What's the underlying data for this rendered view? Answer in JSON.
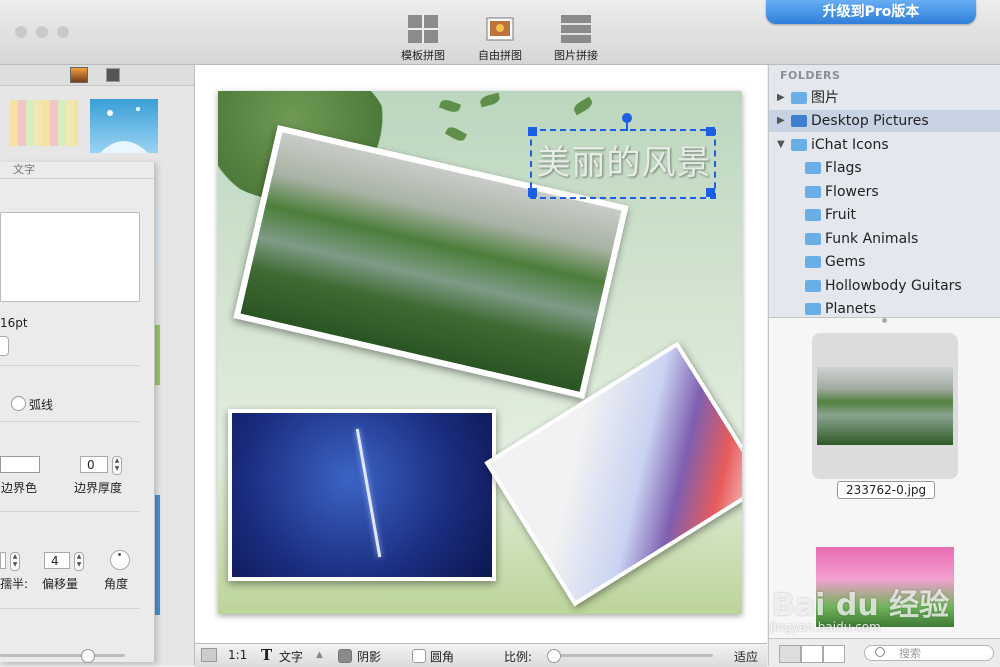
{
  "toolbar": {
    "buttons": [
      "模板拼图",
      "自由拼图",
      "图片拼接"
    ],
    "pro_label": "升级到Pro版本"
  },
  "left_panel": {
    "text_panel_title": "文字",
    "font_size": "16pt",
    "arc_label": "弧线",
    "border_color_label": "边界色",
    "border_width_label": "边界厚度",
    "border_width_value": "0",
    "radius_label": "孺半:",
    "offset_label": "偏移量",
    "offset_value": "4",
    "angle_label": "角度"
  },
  "canvas": {
    "title_text": "美丽的风景"
  },
  "bottom_bar": {
    "ratio_label": "1:1",
    "text_label": "文字",
    "shadow_label": "阴影",
    "shadow_checked": true,
    "round_corner_label": "圆角",
    "round_corner_checked": false,
    "scale_label": "比例:",
    "fit_label": "适应"
  },
  "right_panel": {
    "section_header": "FOLDERS",
    "folders": [
      {
        "label": "图片",
        "level": 0,
        "expanded": false,
        "selected": false
      },
      {
        "label": "Desktop Pictures",
        "level": 0,
        "expanded": false,
        "selected": true
      },
      {
        "label": "iChat Icons",
        "level": 0,
        "expanded": true,
        "selected": false
      },
      {
        "label": "Flags",
        "level": 1
      },
      {
        "label": "Flowers",
        "level": 1
      },
      {
        "label": "Fruit",
        "level": 1
      },
      {
        "label": "Funk Animals",
        "level": 1
      },
      {
        "label": "Gems",
        "level": 1
      },
      {
        "label": "Hollowbody Guitars",
        "level": 1
      },
      {
        "label": "Planets",
        "level": 1
      }
    ],
    "selected_file": "233762-0.jpg",
    "search_placeholder": "搜索"
  },
  "watermark": {
    "brand": "Bai du 经验",
    "url": "jingyan.baidu.com"
  }
}
